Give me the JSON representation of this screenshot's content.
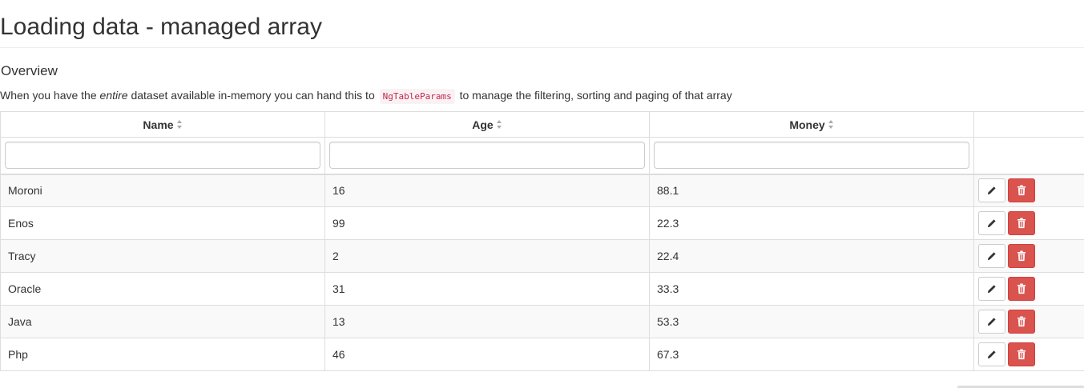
{
  "page": {
    "title": "Loading data - managed array",
    "section_title": "Overview",
    "description": {
      "part1": "When you have the ",
      "emphasis": "entire",
      "part2": " dataset available in-memory you can hand this to ",
      "code": "NgTableParams",
      "part3": " to manage the filtering, sorting and paging of that array"
    }
  },
  "table": {
    "columns": [
      {
        "label": "Name",
        "sortable": true
      },
      {
        "label": "Age",
        "sortable": true
      },
      {
        "label": "Money",
        "sortable": true
      },
      {
        "label": "",
        "sortable": false
      }
    ],
    "filters": {
      "name": {
        "value": "",
        "placeholder": ""
      },
      "age": {
        "value": "",
        "placeholder": ""
      },
      "money": {
        "value": "",
        "placeholder": ""
      }
    },
    "rows": [
      {
        "name": "Moroni",
        "age": "16",
        "money": "88.1"
      },
      {
        "name": "Enos",
        "age": "99",
        "money": "22.3"
      },
      {
        "name": "Tracy",
        "age": "2",
        "money": "22.4"
      },
      {
        "name": "Oracle",
        "age": "31",
        "money": "33.3"
      },
      {
        "name": "Java",
        "age": "13",
        "money": "53.3"
      },
      {
        "name": "Php",
        "age": "46",
        "money": "67.3"
      }
    ],
    "row_actions": {
      "edit_icon": "pencil-icon",
      "delete_icon": "trash-icon"
    }
  },
  "colors": {
    "danger": "#d9534f",
    "code_text": "#c7254e",
    "code_bg": "#f9f2f4",
    "stripe": "#f9f9f9",
    "border": "#dddddd"
  }
}
